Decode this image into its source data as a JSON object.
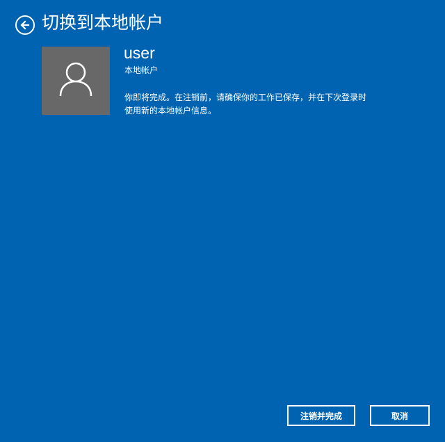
{
  "header": {
    "title": "切换到本地帐户",
    "back_icon": "back-arrow-icon"
  },
  "account": {
    "avatar_icon": "user-avatar-icon",
    "name": "user",
    "type": "本地帐户"
  },
  "message": {
    "line1": "你即将完成。在注销前，请确保你的工作已保存，并在下次登录时",
    "line2": "使用新的本地帐户信息。"
  },
  "buttons": {
    "sign_out_finish": "注销并完成",
    "cancel": "取消"
  },
  "colors": {
    "background": "#0063b1",
    "avatar_background": "#686868",
    "text": "#ffffff"
  }
}
